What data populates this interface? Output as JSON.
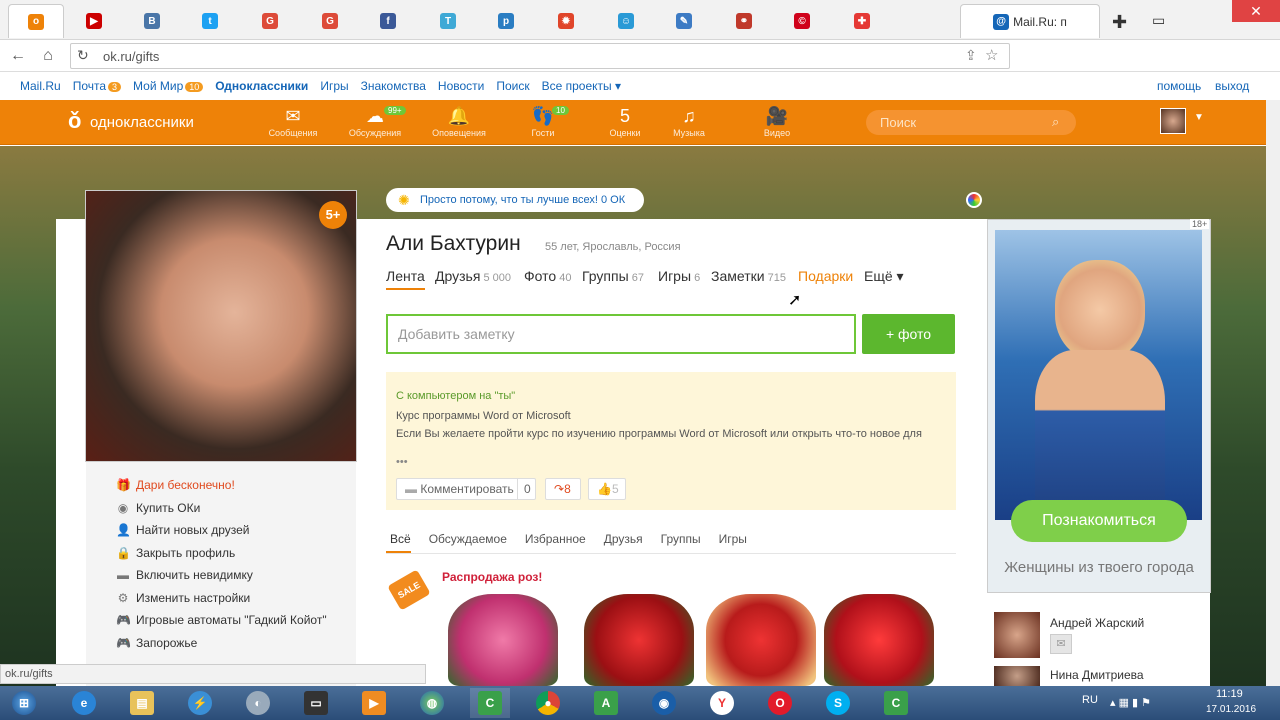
{
  "browser": {
    "tabs": [
      {
        "icon": "ok-icon",
        "color": "#ee8208",
        "glyph": "o"
      },
      {
        "icon": "youtube-icon",
        "color": "#cc0000",
        "glyph": "▶"
      },
      {
        "icon": "vk-icon",
        "color": "#4a76a8",
        "glyph": "B"
      },
      {
        "icon": "twitter-icon",
        "color": "#1da1f2",
        "glyph": "t"
      },
      {
        "icon": "google-plus-icon",
        "color": "#dd4b39",
        "glyph": "G"
      },
      {
        "icon": "google-plus-icon",
        "color": "#dd4b39",
        "glyph": "G"
      },
      {
        "icon": "facebook-icon",
        "color": "#3b5998",
        "glyph": "f"
      },
      {
        "icon": "t-icon",
        "color": "#3fa9d6",
        "glyph": "T"
      },
      {
        "icon": "p-icon",
        "color": "#2a7dc2",
        "glyph": "p"
      },
      {
        "icon": "flame-icon",
        "color": "#e0452a",
        "glyph": "✹"
      },
      {
        "icon": "smile-icon",
        "color": "#2a9ad6",
        "glyph": "☺"
      },
      {
        "icon": "doc-icon",
        "color": "#3d7bc4",
        "glyph": "✎"
      },
      {
        "icon": "link-icon",
        "color": "#c0392b",
        "glyph": "⚭"
      },
      {
        "icon": "c-icon",
        "color": "#d0021b",
        "glyph": "©"
      },
      {
        "icon": "shield-icon",
        "color": "#e53935",
        "glyph": "✚"
      },
      {
        "icon": "tool-icon",
        "color": "#555555",
        "glyph": "✱"
      }
    ],
    "active_tab_title": "Mail.Ru: п",
    "url": "ok.ru/gifts"
  },
  "mailbar": {
    "items": [
      "Mail.Ru",
      "Почта",
      "Мой Мир",
      "Одноклассники",
      "Игры",
      "Знакомства",
      "Новости",
      "Поиск",
      "Все проекты ▾"
    ],
    "pochta_badge": "3",
    "mymir_badge": "10",
    "help": "помощь",
    "logout": "выход"
  },
  "okheader": {
    "logo": "одноклассники",
    "icons": [
      {
        "label": "Сообщения",
        "glyph": "✉",
        "badge": ""
      },
      {
        "label": "Обсуждения",
        "glyph": "☁",
        "badge": "99+"
      },
      {
        "label": "Оповещения",
        "glyph": "🔔",
        "badge": ""
      },
      {
        "label": "Гости",
        "glyph": "👣",
        "badge": "10"
      },
      {
        "label": "Оценки",
        "glyph": "5",
        "badge": ""
      },
      {
        "label": "Музыка",
        "glyph": "♫",
        "badge": ""
      },
      {
        "label": "Видео",
        "glyph": "🎥",
        "badge": ""
      }
    ],
    "search_placeholder": "Поиск"
  },
  "profile": {
    "status_pill": "Просто потому, что ты лучше всех! 0 ОК",
    "name": "Али Бахтурин",
    "info": "55 лет, Ярославль, Россия",
    "badge": "5+",
    "tabs": [
      {
        "label": "Лента",
        "count": ""
      },
      {
        "label": "Друзья",
        "count": "5 000"
      },
      {
        "label": "Фото",
        "count": "40"
      },
      {
        "label": "Группы",
        "count": "67"
      },
      {
        "label": "Игры",
        "count": "6"
      },
      {
        "label": "Заметки",
        "count": "715"
      },
      {
        "label": "Подарки",
        "count": ""
      },
      {
        "label": "Ещё ▾",
        "count": ""
      }
    ],
    "note_placeholder": "Добавить заметку",
    "photo_button": "+ фото"
  },
  "leftmenu": [
    {
      "label": "Дари бесконечно!",
      "icon": "gift-icon",
      "highlight": true
    },
    {
      "label": "Купить ОКи",
      "icon": "coin-icon",
      "highlight": false
    },
    {
      "label": "Найти новых друзей",
      "icon": "user-icon",
      "highlight": false
    },
    {
      "label": "Закрыть профиль",
      "icon": "lock-icon",
      "highlight": false
    },
    {
      "label": "Включить невидимку",
      "icon": "invisible-icon",
      "highlight": false
    },
    {
      "label": "Изменить настройки",
      "icon": "gear-icon",
      "highlight": false
    },
    {
      "label": "Игровые автоматы \"Гадкий Койот\"",
      "icon": "game-icon",
      "highlight": false
    },
    {
      "label": "Запорожье",
      "icon": "game-icon",
      "highlight": false
    }
  ],
  "post": {
    "title": "С компьютером на \"ты\"",
    "line1": "Курс программы Word от Microsoft",
    "line2": "Если Вы желаете пройти курс по изучению программы Word от Microsoft или открыть что-то новое для",
    "dots": "•••",
    "comment": "Комментировать",
    "comment_count": "0",
    "share_count": "8",
    "like_count": "5"
  },
  "feedtabs": [
    "Всё",
    "Обсуждаемое",
    "Избранное",
    "Друзья",
    "Группы",
    "Игры"
  ],
  "sale": {
    "badge": "SALE",
    "title": "Распродажа роз!"
  },
  "ad": {
    "age": "18+",
    "button": "Познакомиться",
    "caption": "Женщины из твоего города"
  },
  "friends": [
    {
      "name": "Андрей Жарский"
    },
    {
      "name": "Нина Дмитриева"
    }
  ],
  "status_url": "ok.ru/gifts",
  "taskbar": {
    "lang": "RU",
    "time": "11:19",
    "date": "17.01.2016"
  }
}
